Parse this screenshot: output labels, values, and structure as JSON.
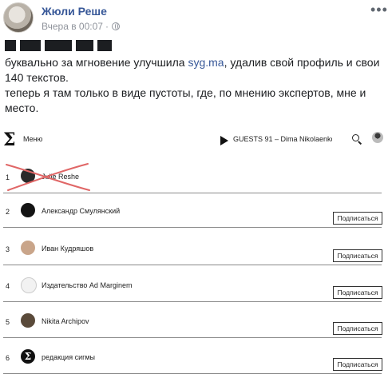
{
  "post": {
    "author": "Жюли Реше",
    "timestamp": "Вчера в 00:07",
    "separator": "·",
    "more_icon": "•••",
    "text_before_link": "буквально за мгновение улучшила ",
    "link_text": "syg.ma",
    "text_after_link": ", удалив свой профиль и свои 140 текстов.",
    "text_line2": "теперь я там только в виде пустоты, где, по мнению экспертов, мне и место."
  },
  "sigma": {
    "logo": "Σ",
    "menu_label": "Меню",
    "now_playing": "GUESTS 91 – Dima Nikolaenko",
    "rows": [
      {
        "rank": "1",
        "name": "Julie Reshe",
        "subscribe": "",
        "avatar_color": "#2a2a2a",
        "struck": true
      },
      {
        "rank": "2",
        "name": "Александр Смулянский",
        "subscribe": "Подписаться",
        "avatar_color": "#141414"
      },
      {
        "rank": "3",
        "name": "Иван Кудряшов",
        "subscribe": "Подписаться",
        "avatar_color": "#c9a58a"
      },
      {
        "rank": "4",
        "name": "Издательство Ad Marginem",
        "subscribe": "Подписаться",
        "avatar_color": "#f2f2f2"
      },
      {
        "rank": "5",
        "name": "Nikita Archipov",
        "subscribe": "Подписаться",
        "avatar_color": "#5a4a3a"
      },
      {
        "rank": "6",
        "name": "редакция сигмы",
        "subscribe": "Подписаться",
        "avatar_color": "#111111",
        "badge": "Σ"
      }
    ]
  },
  "colors": {
    "link": "#385898",
    "strike": "#e06666"
  }
}
